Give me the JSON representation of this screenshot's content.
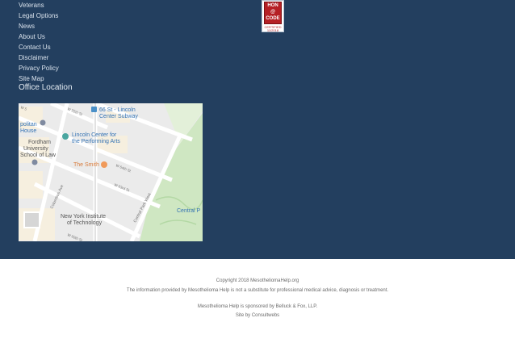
{
  "nav": {
    "items": [
      "Veterans",
      "Legal Options",
      "News",
      "About Us",
      "Contact Us",
      "Disclaimer",
      "Privacy Policy",
      "Site Map"
    ]
  },
  "office": {
    "heading": "Office Location"
  },
  "badge": {
    "line1": "HON",
    "line2": "@",
    "line3": "CODE",
    "cert1": "CERTIFIED",
    "cert2": "11/2018"
  },
  "map": {
    "labels": {
      "subway": "66 St - Lincoln\nCenter Subway",
      "lincoln": "Lincoln Center for\nthe Performing Arts",
      "smith": "The Smith",
      "fordham": "Fordham\nUniversity\nSchool of Law",
      "politan": "politan\nHouse",
      "nyit": "New York Institute\nof Technology",
      "central_park_west": "Central Park West",
      "central_park": "Central P",
      "columbus": "Columbus Ave",
      "w65": "W 65th St",
      "w64": "W 64th St",
      "w63": "W 63rd St",
      "w62": "W 62nd St",
      "w61": "W 61st St",
      "w60": "W 60th St",
      "w55": "W 55th St",
      "w5": "W 5"
    }
  },
  "footer": {
    "copyright": "Copyright 2018 MesotheliomaHelp.org",
    "disclaimer": "The information provided by Mesothelioma Help is not a substitute for professional medical advice, diagnosis or treatment.",
    "sponsor": "Mesothelioma Help is sponsored by Belluck & Fox, LLP.",
    "credit": "Site by Consultwebs"
  }
}
